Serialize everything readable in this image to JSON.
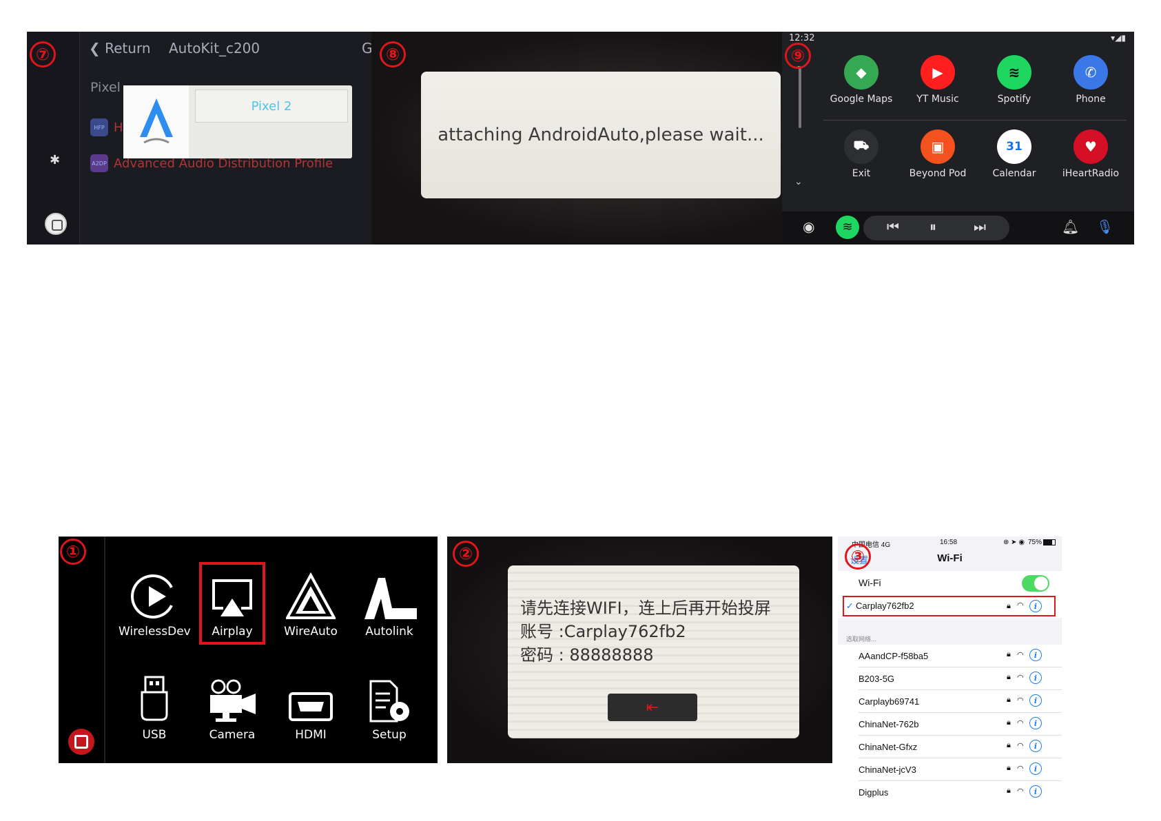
{
  "steps": {
    "s7": "⑦",
    "s8": "⑧",
    "s9": "⑨",
    "s1": "①",
    "s2": "②",
    "s3": "③"
  },
  "panel7": {
    "return_label": "Return",
    "app_name": "AutoKit_c200",
    "guide_label": "Guide",
    "device_label": "Pixel",
    "dialog_device": "Pixel 2",
    "profiles": [
      {
        "badge": "HFP",
        "label": "H"
      },
      {
        "badge": "A2DP",
        "label": "Advanced Audio Distribution Profile"
      }
    ]
  },
  "panel8": {
    "message": "attaching AndroidAuto,please wait..."
  },
  "panel9": {
    "time": "12:32",
    "apps": [
      {
        "label": "Google Maps",
        "color": "#34a853",
        "glyph": "◆"
      },
      {
        "label": "YT Music",
        "color": "#ff1f1f",
        "glyph": "▶"
      },
      {
        "label": "Spotify",
        "color": "#1ed760",
        "glyph": "≋"
      },
      {
        "label": "Phone",
        "color": "#3b78e7",
        "glyph": "✆"
      },
      {
        "label": "Exit",
        "color": "#2e2f33",
        "glyph": "🚘"
      },
      {
        "label": "Beyond Pod",
        "color": "#f4511e",
        "glyph": "▣"
      },
      {
        "label": "Calendar",
        "color": "#ffffff",
        "glyph": "31"
      },
      {
        "label": "iHeartRadio",
        "color": "#d50f25",
        "glyph": "♥"
      }
    ]
  },
  "panel1": {
    "tiles": [
      {
        "label": "WirelessDev"
      },
      {
        "label": "Airplay"
      },
      {
        "label": "WireAuto"
      },
      {
        "label": "Autolink"
      },
      {
        "label": "USB"
      },
      {
        "label": "Camera"
      },
      {
        "label": "HDMI"
      },
      {
        "label": "Setup"
      }
    ]
  },
  "panel2": {
    "line1": "请先连接WIFI，连上后再开始投屏",
    "line2": "账号 :Carplay762fb2",
    "line3": "密码 : 88888888"
  },
  "panel3": {
    "carrier": "中国电信  4G",
    "time": "16:58",
    "battery": "75%",
    "back": "设置",
    "title": "Wi-Fi",
    "wifi_label": "Wi-Fi",
    "connected": "Carplay762fb2",
    "section": "选取网络...",
    "networks": [
      "AAandCP-f58ba5",
      "B203-5G",
      "Carplayb69741",
      "ChinaNet-762b",
      "ChinaNet-Gfxz",
      "ChinaNet-jcV3",
      "Digplus"
    ]
  }
}
